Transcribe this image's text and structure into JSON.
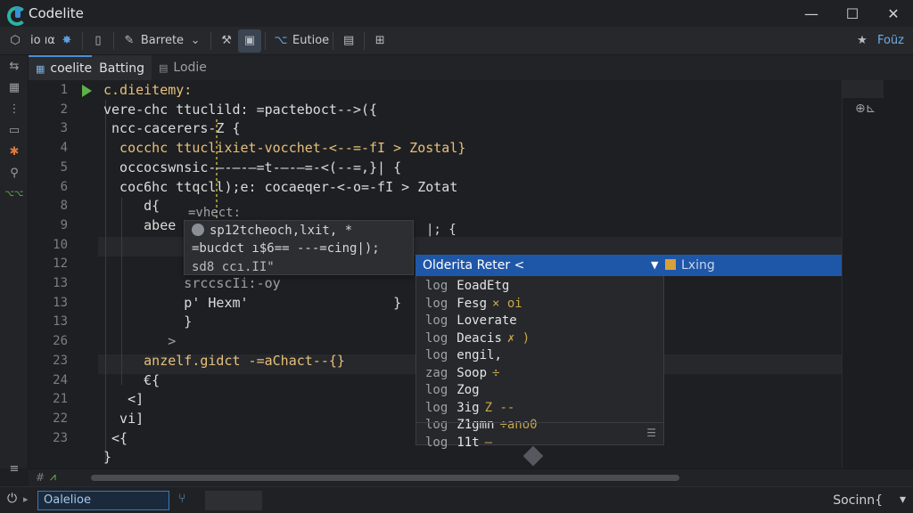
{
  "window": {
    "title": "Codelite",
    "minimize": "—",
    "maximize": "☐",
    "close": "✕"
  },
  "toolbar": {
    "workspace_label": "io ıα",
    "build_label": "Barrete",
    "build_chevron": "⌄",
    "debug_label": "Eutioe",
    "right_label": "Foüz"
  },
  "tabs": [
    {
      "label": "coelite"
    },
    {
      "label": "Batting"
    },
    {
      "label": "Lodie"
    }
  ],
  "line_numbers": [
    "1",
    "2",
    "3",
    "4",
    "5",
    "6",
    "8",
    "9",
    "10",
    "12",
    "13",
    "13",
    "13",
    "26",
    "23",
    "24",
    "21",
    "22",
    "23"
  ],
  "code_lines": [
    "c.dieitemy:",
    "vere-chc ttuclild: =pacteboct-->({",
    " ncc-cacerers-Z {",
    "  cocchc ttuclixiet-vocchet-<--=-fI > Zostal}",
    "  occocswnsic-—-—-—=t-—-—=-<(--=,}| {",
    "  coc6hc ttqcll);e: cocaeqer-<-o=-fI > Zotat",
    "     d{",
    "     abee",
    "",
    "          p'",
    "          srccscIi:-oy",
    "          p' Hexm'                  }",
    "          }",
    "        >",
    "     anzelf.gidct -=aChact--{}",
    "     €{",
    "   <]",
    "  vi]",
    " <{",
    "}",
    ">"
  ],
  "hover": {
    "line1": "=vhect:",
    "line2": "sp12tcheoch,lxit, *",
    "line2_tail": "|;   {",
    "line3": "=bucdct ı$6== ---=cing|);",
    "line4": "sd8 ccı.II\""
  },
  "autocomplete": {
    "header": "Olderita  Reter <",
    "header_right": "Lxing",
    "items": [
      {
        "kind": "log",
        "name": "EoadEtg",
        "extra": ""
      },
      {
        "kind": "log",
        "name": "Fesg",
        "extra": "× oi"
      },
      {
        "kind": "log",
        "name": "Loverate",
        "extra": ""
      },
      {
        "kind": "log",
        "name": "Deacis",
        "extra": "✗ )"
      },
      {
        "kind": "log",
        "name": "engil,",
        "extra": ""
      },
      {
        "kind": "zag",
        "name": "Soop",
        "extra": "÷"
      },
      {
        "kind": "log",
        "name": "Zog",
        "extra": ""
      },
      {
        "kind": "log",
        "name": "3ig",
        "extra": "Z --"
      },
      {
        "kind": "log",
        "name": "Z1gmn",
        "extra": "÷ano0"
      },
      {
        "kind": "log",
        "name": "11t",
        "extra": "—"
      }
    ]
  },
  "minimap": {
    "badge": "⊕⊾"
  },
  "status": {
    "input_value": "Oalelioe",
    "right_text": "Socinn{"
  }
}
